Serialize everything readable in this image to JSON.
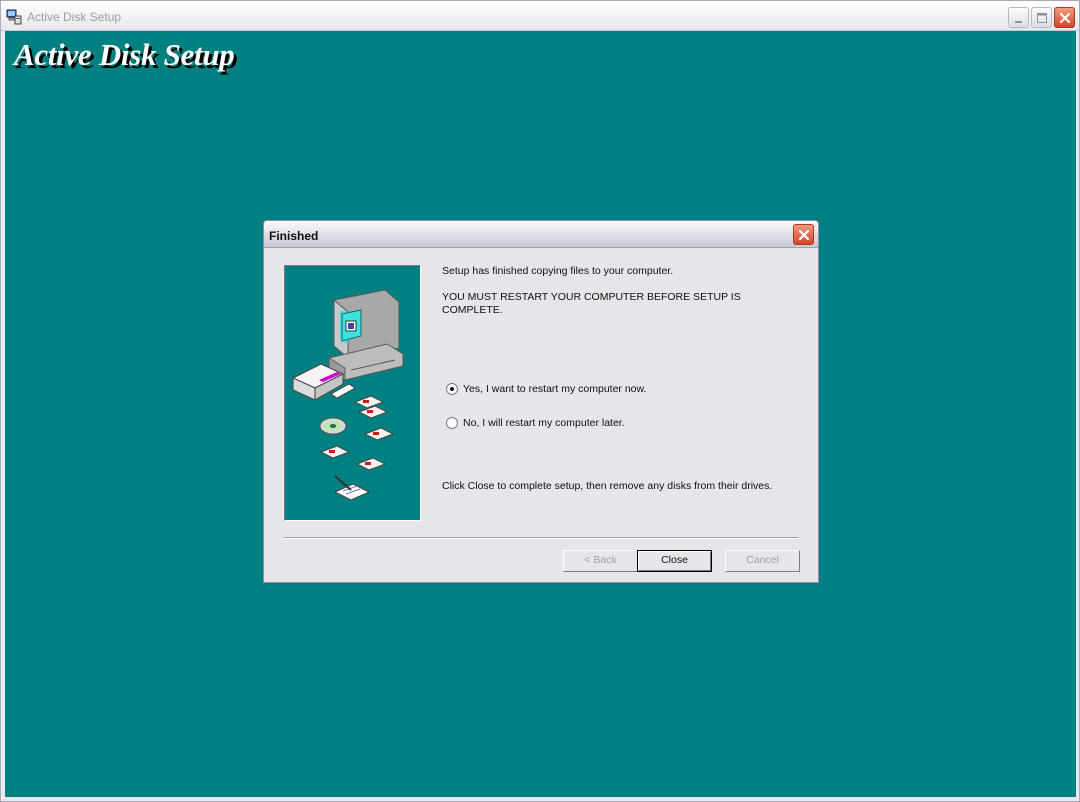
{
  "window": {
    "title": "Active Disk Setup",
    "controls": [
      "minimize-icon",
      "maximize-icon",
      "close-icon"
    ]
  },
  "client": {
    "heading": "Active Disk Setup",
    "background": "#008080"
  },
  "dialog": {
    "title": "Finished",
    "message_1": "Setup has finished copying files to your computer.",
    "message_2": "YOU MUST RESTART YOUR COMPUTER BEFORE SETUP IS COMPLETE.",
    "options": [
      {
        "label": "Yes, I want to restart my computer now.",
        "selected": true
      },
      {
        "label": "No, I will restart my computer later.",
        "selected": false
      }
    ],
    "footer_text": "Click Close to complete setup, then remove any disks from their drives.",
    "buttons": {
      "back": "< Back",
      "close": "Close",
      "cancel": "Cancel"
    }
  },
  "colors": {
    "desktop_teal": "#008080",
    "dialog_face": "#e5e5ea",
    "close_red": "#d4462a"
  }
}
